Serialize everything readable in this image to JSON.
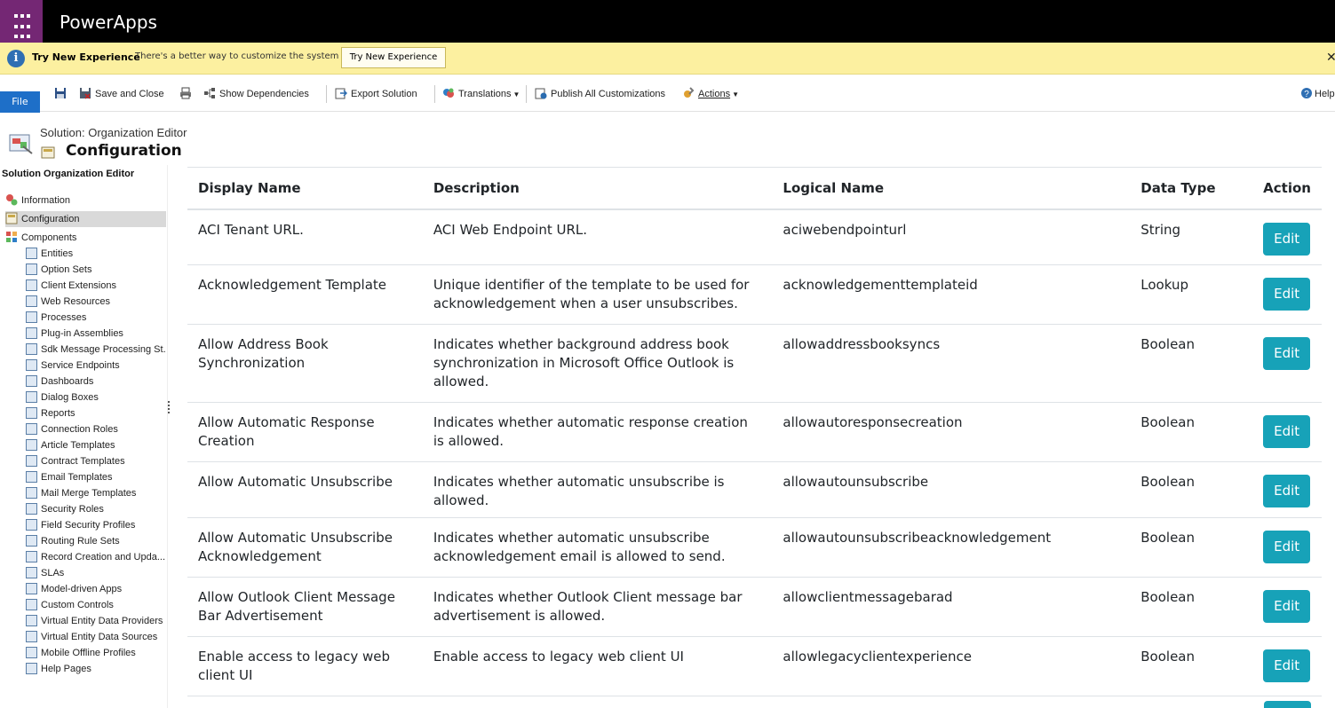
{
  "app": {
    "title": "PowerApps"
  },
  "notice": {
    "title": "Try New Experience",
    "message": "There's a better way to customize the system",
    "button": "Try New Experience",
    "close": "✕"
  },
  "ribbon": {
    "file": "File",
    "save_close": "Save and Close",
    "show_dependencies": "Show Dependencies",
    "export_solution": "Export Solution",
    "translations": "Translations",
    "publish_all": "Publish All Customizations",
    "actions": "Actions",
    "help": "Help"
  },
  "header": {
    "breadcrumb": "Solution: Organization Editor",
    "title": "Configuration"
  },
  "sidebar": {
    "title": "Solution Organization Editor",
    "top_items": [
      {
        "label": "Information"
      },
      {
        "label": "Configuration"
      },
      {
        "label": "Components"
      }
    ],
    "components": [
      "Entities",
      "Option Sets",
      "Client Extensions",
      "Web Resources",
      "Processes",
      "Plug-in Assemblies",
      "Sdk Message Processing St...",
      "Service Endpoints",
      "Dashboards",
      "Dialog Boxes",
      "Reports",
      "Connection Roles",
      "Article Templates",
      "Contract Templates",
      "Email Templates",
      "Mail Merge Templates",
      "Security Roles",
      "Field Security Profiles",
      "Routing Rule Sets",
      "Record Creation and Upda...",
      "SLAs",
      "Model-driven Apps",
      "Custom Controls",
      "Virtual Entity Data Providers",
      "Virtual Entity Data Sources",
      "Mobile Offline Profiles",
      "Help Pages"
    ]
  },
  "table": {
    "columns": [
      "Display Name",
      "Description",
      "Logical Name",
      "Data Type",
      "Action"
    ],
    "edit_label": "Edit",
    "rows": [
      {
        "display": "ACI Tenant URL.",
        "description": "ACI Web Endpoint URL.",
        "logical": "aciwebendpointurl",
        "type": "String"
      },
      {
        "display": "Acknowledgement Template",
        "description": "Unique identifier of the template to be used for acknowledgement when a user unsubscribes.",
        "logical": "acknowledgementtemplateid",
        "type": "Lookup"
      },
      {
        "display": "Allow Address Book Synchronization",
        "description": "Indicates whether background address book synchronization in Microsoft Office Outlook is allowed.",
        "logical": "allowaddressbooksyncs",
        "type": "Boolean"
      },
      {
        "display": "Allow Automatic Response Creation",
        "description": "Indicates whether automatic response creation is allowed.",
        "logical": "allowautoresponsecreation",
        "type": "Boolean"
      },
      {
        "display": "Allow Automatic Unsubscribe",
        "description": "Indicates whether automatic unsubscribe is allowed.",
        "logical": "allowautounsubscribe",
        "type": "Boolean"
      },
      {
        "display": "Allow Automatic Unsubscribe Acknowledgement",
        "description": "Indicates whether automatic unsubscribe acknowledgement email is allowed to send.",
        "logical": "allowautounsubscribeacknowledgement",
        "type": "Boolean"
      },
      {
        "display": "Allow Outlook Client Message Bar Advertisement",
        "description": "Indicates whether Outlook Client message bar advertisement is allowed.",
        "logical": "allowclientmessagebarad",
        "type": "Boolean"
      },
      {
        "display": "Enable access to legacy web client UI",
        "description": "Enable access to legacy web client UI",
        "logical": "allowlegacyclientexperience",
        "type": "Boolean"
      }
    ]
  }
}
